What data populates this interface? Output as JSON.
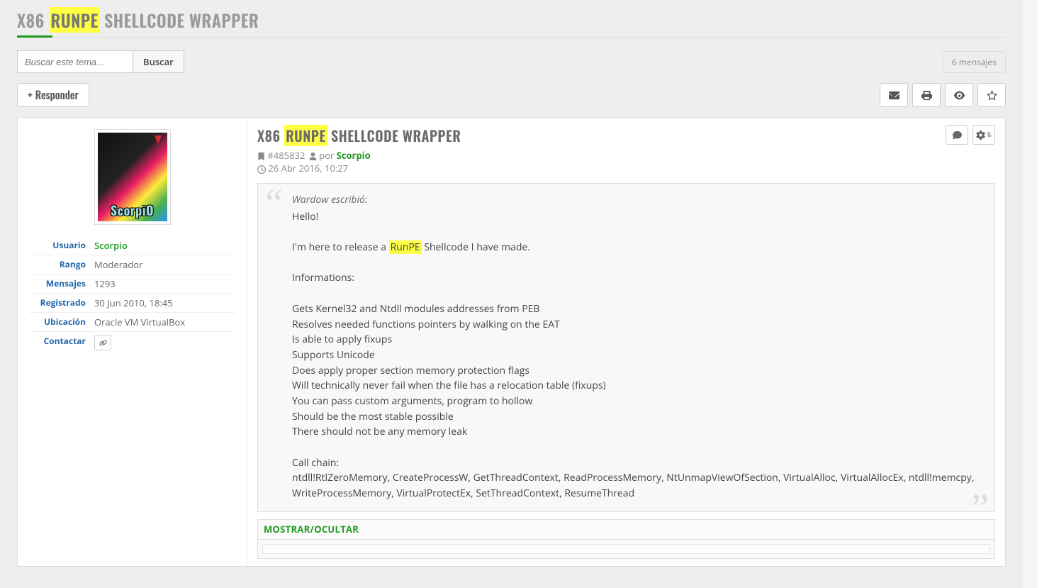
{
  "page": {
    "title_prefix": "X86 ",
    "title_highlight": "RUNPE",
    "title_suffix": " SHELLCODE WRAPPER"
  },
  "search": {
    "placeholder": "Buscar este tema…",
    "button": "Buscar"
  },
  "count_label": "6 mensajes",
  "reply_label": "Responder",
  "profile": {
    "avatar_name": "ScorpiO",
    "rows": {
      "user_label": "Usuario",
      "user_value": "Scorpio",
      "rank_label": "Rango",
      "rank_value": "Moderador",
      "posts_label": "Mensajes",
      "posts_value": "1293",
      "joined_label": "Registrado",
      "joined_value": "30 Jun 2010, 18:45",
      "location_label": "Ubicación",
      "location_value": "Oracle VM VirtualBox",
      "contact_label": "Contactar"
    }
  },
  "post": {
    "title_prefix": "X86 ",
    "title_highlight": "RUNPE",
    "title_suffix": " Shellcode Wrapper",
    "id": "#485832",
    "by": "por",
    "author": "Scorpio",
    "date": "26 Abr 2016, 10:27",
    "quote": {
      "cite": "Wardow escribió:",
      "line1": "Hello!",
      "line2a": "I'm here to release a ",
      "line2hl": "RunPE",
      "line2b": " Shellcode I have made.",
      "info_header": "Informations:",
      "b1": "Gets Kernel32 and Ntdll modules addresses from PEB",
      "b2": "Resolves needed functions pointers by walking on the EAT",
      "b3": "Is able to apply fixups",
      "b4": "Supports Unicode",
      "b5": "Does apply proper section memory protection flags",
      "b6": "Will technically never fail when the file has a relocation table (fixups)",
      "b7": "You can pass custom arguments, program to hollow",
      "b8": "Should be the most stable possible",
      "b9": "There should not be any memory leak",
      "chain_header": "Call chain:",
      "chain": "ntdll!RtlZeroMemory, CreateProcessW, GetThreadContext, ReadProcessMemory, NtUnmapViewOfSection, VirtualAlloc, VirtualAllocEx, ntdll!memcpy, WriteProcessMemory, VirtualProtectEx, SetThreadContext, ResumeThread"
    },
    "spoiler_toggle": "MOSTRAR/OCULTAR"
  }
}
